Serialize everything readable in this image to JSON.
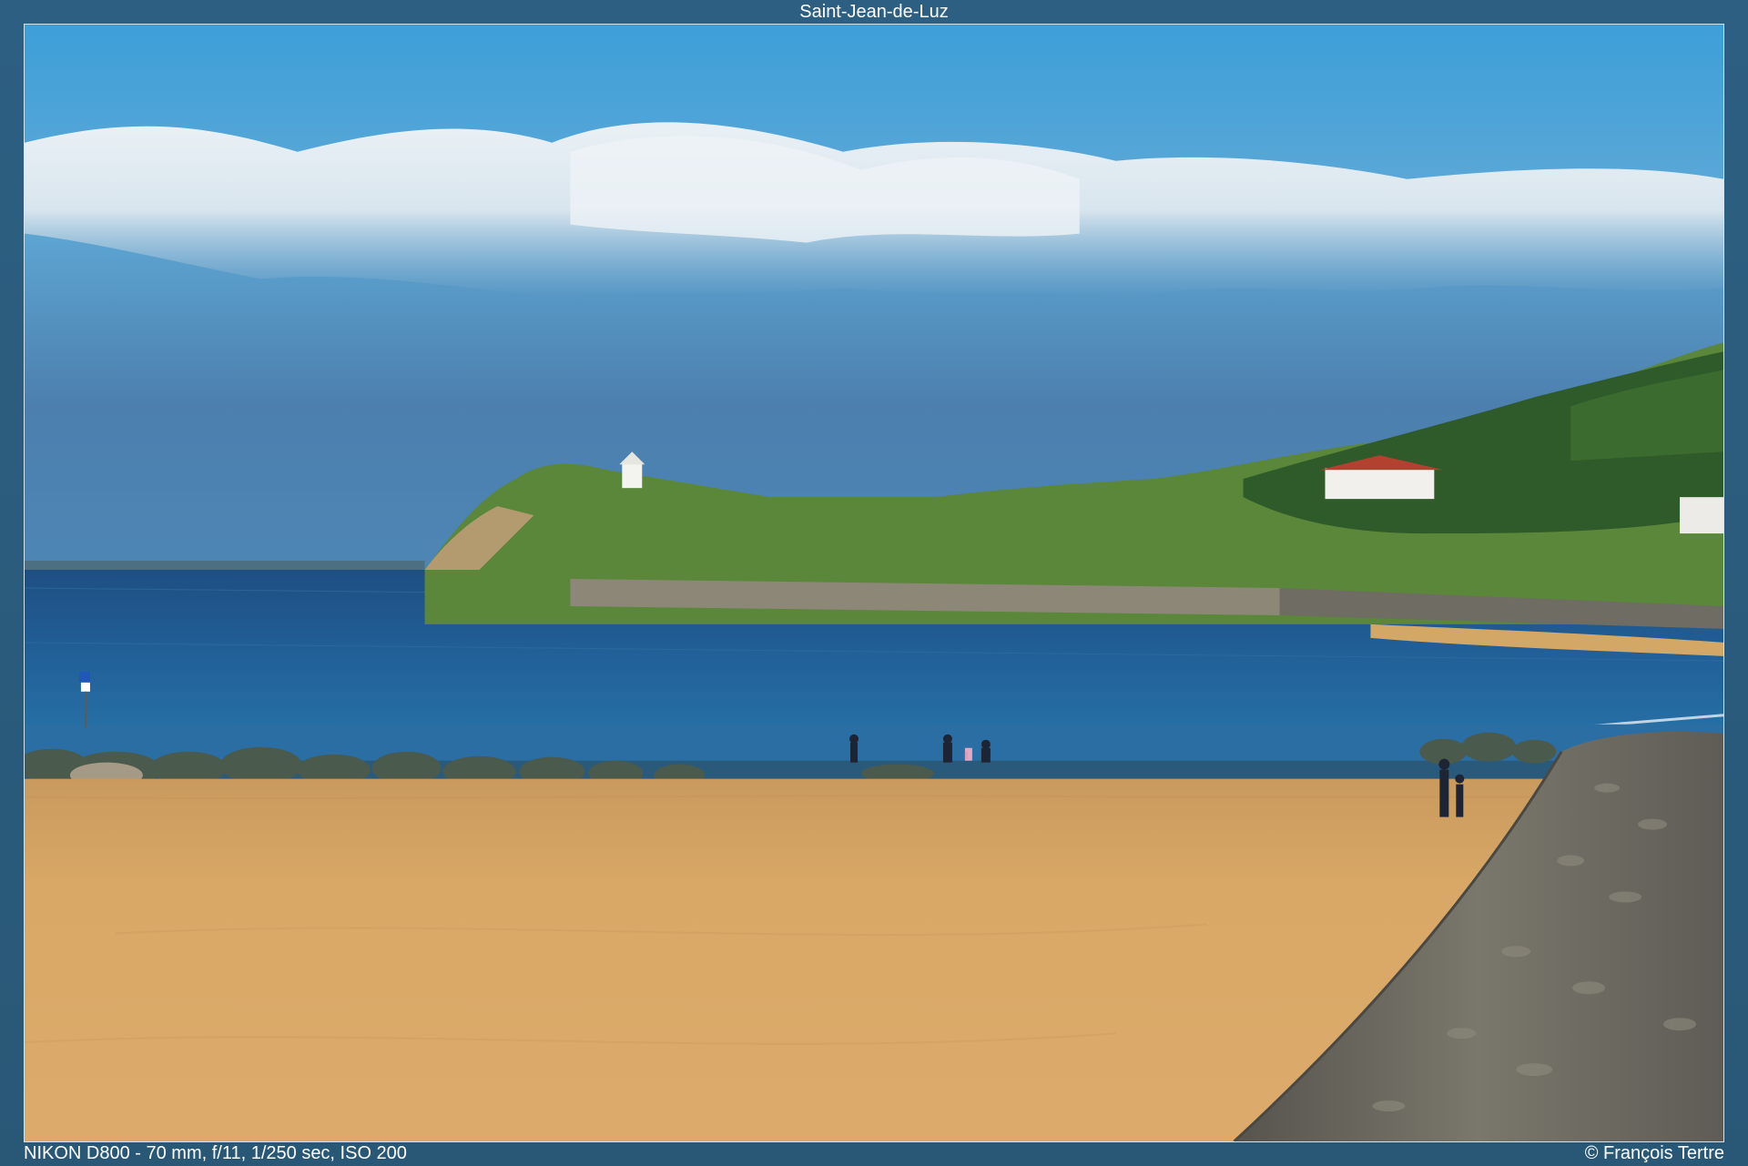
{
  "header": {
    "title": "Saint-Jean-de-Luz"
  },
  "footer": {
    "exif": "NIKON D800 - 70 mm, f/11, 1/250 sec, ISO 200",
    "copyright": "© François Tertre"
  },
  "photo": {
    "subject": "beach-bay-headland",
    "colors": {
      "sky_top": "#3a9fd8",
      "sky_bottom": "#4a86b8",
      "cloud": "#e6edf3",
      "sea": "#1f5f95",
      "sand": "#d9a766",
      "grass": "#5e8d3a",
      "seawall": "#6f6c63",
      "frame": "#2c5d7f"
    }
  }
}
